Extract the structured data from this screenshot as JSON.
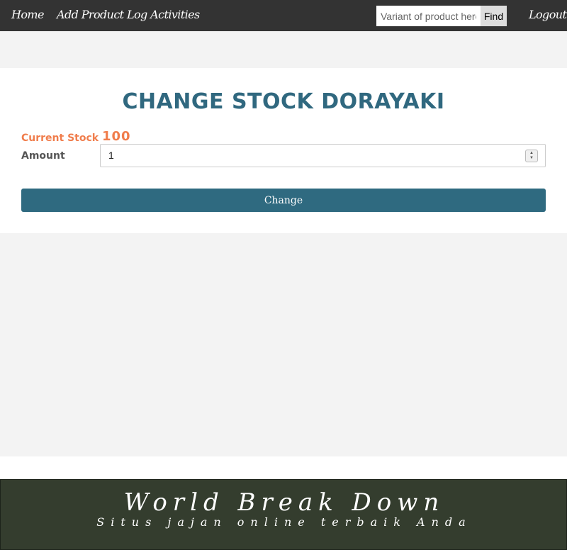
{
  "navbar": {
    "home_label": "Home",
    "add_product_label": "Add Product",
    "log_activities_label": "Log Activities",
    "logout_label": "Logout",
    "search": {
      "placeholder": "Variant of product here",
      "value": ""
    },
    "find_label": "Find"
  },
  "page": {
    "title": "CHANGE STOCK DORAYAKI",
    "current_stock_label": "Current Stock",
    "current_stock_value": "100",
    "amount_label": "Amount",
    "amount_value": "1",
    "change_button_label": "Change"
  },
  "footer": {
    "title": "World Break Down",
    "subtitle": "Situs jajan online terbaik Anda"
  },
  "colors": {
    "navbar_bg": "#333333",
    "accent_title": "#30687f",
    "stock_orange": "#f07d4c",
    "button_bg": "#2f6a80",
    "footer_bg": "#343d2e",
    "page_bg": "#f3f3f3"
  }
}
